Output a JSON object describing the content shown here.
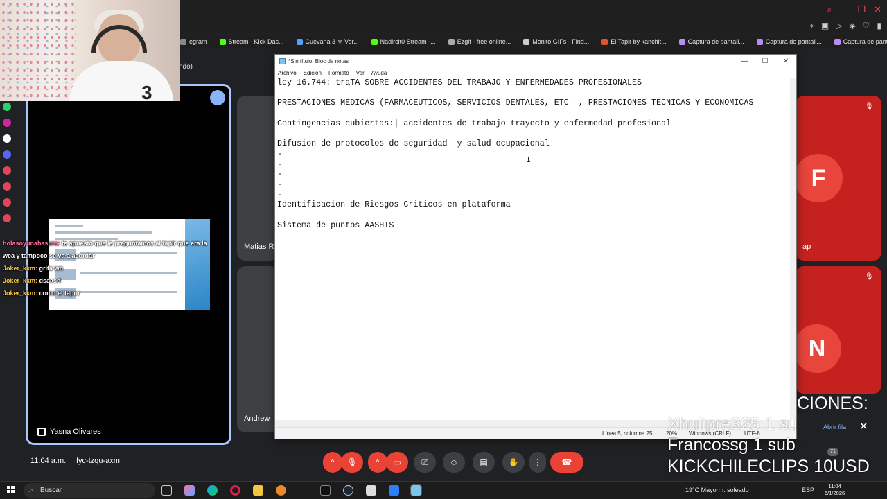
{
  "bookmarks": [
    {
      "label": "egram",
      "color": "#888888"
    },
    {
      "label": "Stream - Kick Das...",
      "color": "#53fc18"
    },
    {
      "label": "Cuevana 3 ⚜ Ver...",
      "color": "#4da3ff"
    },
    {
      "label": "Nadircit0 Stream -...",
      "color": "#53fc18"
    },
    {
      "label": "Ezgif - free online...",
      "color": "#aaaaaa"
    },
    {
      "label": "Monito GIFs - Find...",
      "color": "#cccccc"
    },
    {
      "label": "El Tapir by kanchit...",
      "color": "#e0552d"
    },
    {
      "label": "Captura de pantall...",
      "color": "#b98cf5"
    },
    {
      "label": "Captura de pantall...",
      "color": "#b98cf5"
    },
    {
      "label": "Captura de pantall...",
      "color": "#b98cf5"
    }
  ],
  "tab_strip_text": "ndo)",
  "notepad": {
    "title": "*Sin título: Bloc de notas",
    "menu": [
      "Archivo",
      "Edición",
      "Formato",
      "Ver",
      "Ayuda"
    ],
    "lines": [
      "ley 16.744: traTA SOBRE ACCIDENTES DEL TRABAJO Y ENFERMEDADES PROFESIONALES",
      "",
      "PRESTACIONES MEDICAS (FARMACEUTICOS, SERVICIOS DENTALES, ETC  , PRESTACIONES TECNICAS Y ECONOMICAS",
      "",
      "Contingencias cubiertas:| accidentes de trabajo trayecto y enfermedad profesional",
      "",
      "Difusion de protocolos de seguridad  y salud ocupacional",
      "-",
      "-",
      "-",
      "-",
      "-",
      "Identificacion de Riesgos Criticos en plataforma",
      "",
      "Sistema de puntos AASHIS"
    ],
    "status": {
      "position": "Línea 5, columna 25",
      "zoom": "20%",
      "line_ending": "Windows (CRLF)",
      "encoding": "UTF-8"
    }
  },
  "chat": [
    {
      "user": "holasoyunabasura:",
      "text": " te apuesto que le preguntamos al tapir que era la wea y tampoco se va a acordar"
    },
    {
      "user": "Joker_kkm:",
      "text": " grita wn"
    },
    {
      "user": "Joker_kkm:",
      "text": " dsaasd"
    },
    {
      "user": "Joker_kkm:",
      "text": " como el tapor"
    }
  ],
  "tiles": {
    "presenter_name": "Yasna Olivares",
    "names": [
      "Matias R",
      "ap",
      "Andrew"
    ],
    "avatar_letters": [
      "F",
      "N"
    ]
  },
  "call": {
    "time": "11:04 a.m.",
    "code": "fyc-tzqu-axm",
    "badge": "71"
  },
  "overlay": {
    "notif": "CIONES:",
    "lines": [
      "Xhulipre325 1 sub",
      "Francossg 1 sub",
      "KICKCHILECLIPS 10USD"
    ],
    "toast_label": "Abrir fila"
  },
  "taskbar": {
    "search": "Buscar",
    "weather": "19°C  Mayorm. soleado",
    "lang": "ESP",
    "time": "11:04",
    "date": "6/1/2026"
  },
  "colors": {
    "accent": "#8ab4f8",
    "end_call": "#ea4335",
    "tile_red": "#c5221f"
  }
}
